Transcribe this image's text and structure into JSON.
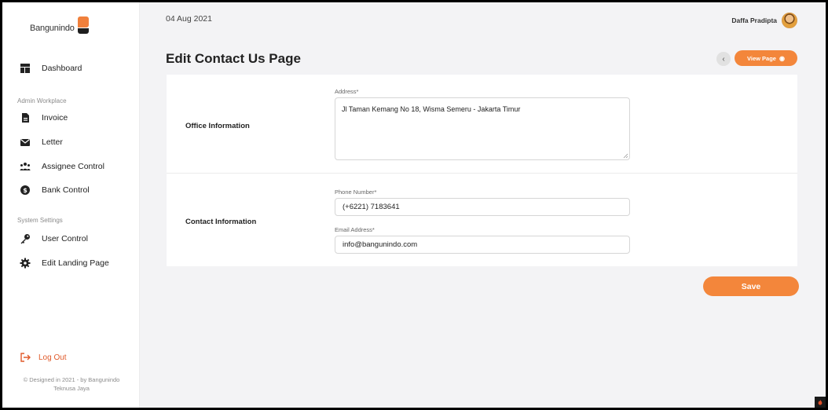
{
  "brand": {
    "name": "Bangunindo"
  },
  "sidebar": {
    "items": [
      {
        "label": "Dashboard",
        "icon": "dashboard-icon"
      },
      {
        "label": "Invoice",
        "icon": "file-icon"
      },
      {
        "label": "Letter",
        "icon": "envelope-icon"
      },
      {
        "label": "Assignee Control",
        "icon": "users-icon"
      },
      {
        "label": "Bank Control",
        "icon": "dollar-circle-icon"
      },
      {
        "label": "User Control",
        "icon": "key-icon"
      },
      {
        "label": "Edit Landing Page",
        "icon": "gear-icon"
      }
    ],
    "sections": {
      "admin": "Admin Workplace",
      "system": "System Settings"
    },
    "logout": "Log Out",
    "footer_line1": "© Designed in 2021 - by Bangunindo",
    "footer_line2": "Teknusa Jaya"
  },
  "header": {
    "date": "04 Aug 2021",
    "user_name": "Daffa Pradipta"
  },
  "page": {
    "title": "Edit Contact Us Page",
    "view_page_label": "View Page",
    "back_icon": "chevron-left-icon",
    "view_icon": "eye-icon"
  },
  "office": {
    "title": "Office Information",
    "address_label": "Address*",
    "address_value": "Jl Taman Kemang No 18, Wisma Semeru - Jakarta Timur"
  },
  "contact": {
    "title": "Contact Information",
    "phone_label": "Phone Number*",
    "phone_value": "(+6221) 7183641",
    "email_label": "Email Address*",
    "email_value": "info@bangunindo.com"
  },
  "actions": {
    "save_label": "Save"
  },
  "colors": {
    "accent": "#f3863b",
    "logout": "#e05a2a",
    "background": "#f3f3f5"
  }
}
